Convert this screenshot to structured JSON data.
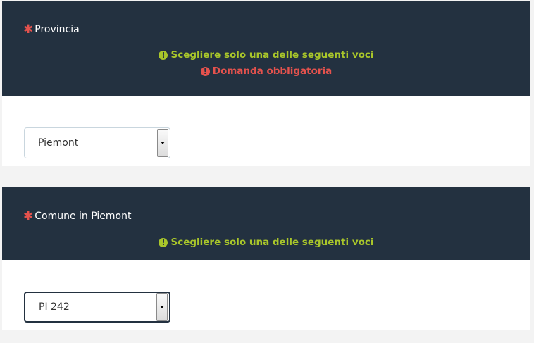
{
  "questions": [
    {
      "asterisk": "✱",
      "title": "Provincia",
      "tips": [
        {
          "icon": "!",
          "text": "Scegliere solo una delle seguenti voci",
          "type": "info"
        },
        {
          "icon": "!",
          "text": "Domanda obbligatoria",
          "type": "error"
        }
      ],
      "select_value": "Piemont"
    },
    {
      "asterisk": "✱",
      "title": "Comune in Piemont",
      "tips": [
        {
          "icon": "!",
          "text": "Scegliere solo una delle seguenti voci",
          "type": "info"
        }
      ],
      "select_value": "PI 242"
    }
  ],
  "colors": {
    "header_bg": "#233140",
    "required": "#e4524d",
    "tip_info": "#a9c62a",
    "tip_error": "#e4524d",
    "page_bg": "#f3f3f3"
  },
  "icons": {
    "asterisk": "asterisk-icon",
    "tip": "exclamation-circle-icon",
    "dropdown": "chevron-down-icon"
  }
}
